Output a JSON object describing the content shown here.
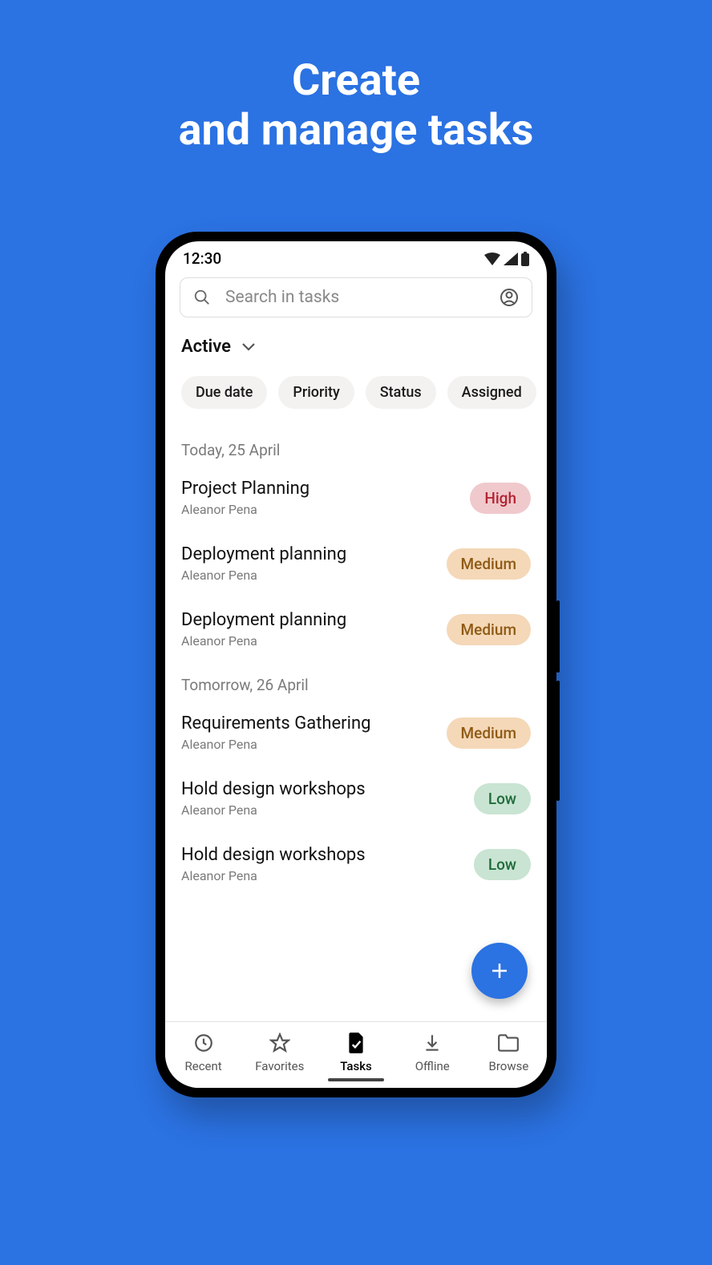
{
  "promo": {
    "line1": "Create",
    "line2": "and manage tasks"
  },
  "status": {
    "time": "12:30"
  },
  "search": {
    "placeholder": "Search in tasks"
  },
  "filter": {
    "label": "Active"
  },
  "chips": [
    "Due date",
    "Priority",
    "Status",
    "Assigned"
  ],
  "sections": [
    {
      "header": "Today, 25 April",
      "tasks": [
        {
          "title": "Project Planning",
          "sub": "Aleanor Pena",
          "priority": "High",
          "level": "high"
        },
        {
          "title": "Deployment planning",
          "sub": "Aleanor Pena",
          "priority": "Medium",
          "level": "medium"
        },
        {
          "title": "Deployment planning",
          "sub": "Aleanor Pena",
          "priority": "Medium",
          "level": "medium"
        }
      ]
    },
    {
      "header": "Tomorrow, 26 April",
      "tasks": [
        {
          "title": "Requirements Gathering",
          "sub": "Aleanor Pena",
          "priority": "Medium",
          "level": "medium"
        },
        {
          "title": "Hold design workshops",
          "sub": "Aleanor Pena",
          "priority": "Low",
          "level": "low"
        },
        {
          "title": "Hold design workshops",
          "sub": "Aleanor Pena",
          "priority": "Low",
          "level": "low"
        }
      ]
    }
  ],
  "nav": [
    {
      "label": "Recent",
      "icon": "clock-icon"
    },
    {
      "label": "Favorites",
      "icon": "star-icon"
    },
    {
      "label": "Tasks",
      "icon": "tasks-icon"
    },
    {
      "label": "Offline",
      "icon": "download-icon"
    },
    {
      "label": "Browse",
      "icon": "folder-icon"
    }
  ],
  "nav_active": 2
}
